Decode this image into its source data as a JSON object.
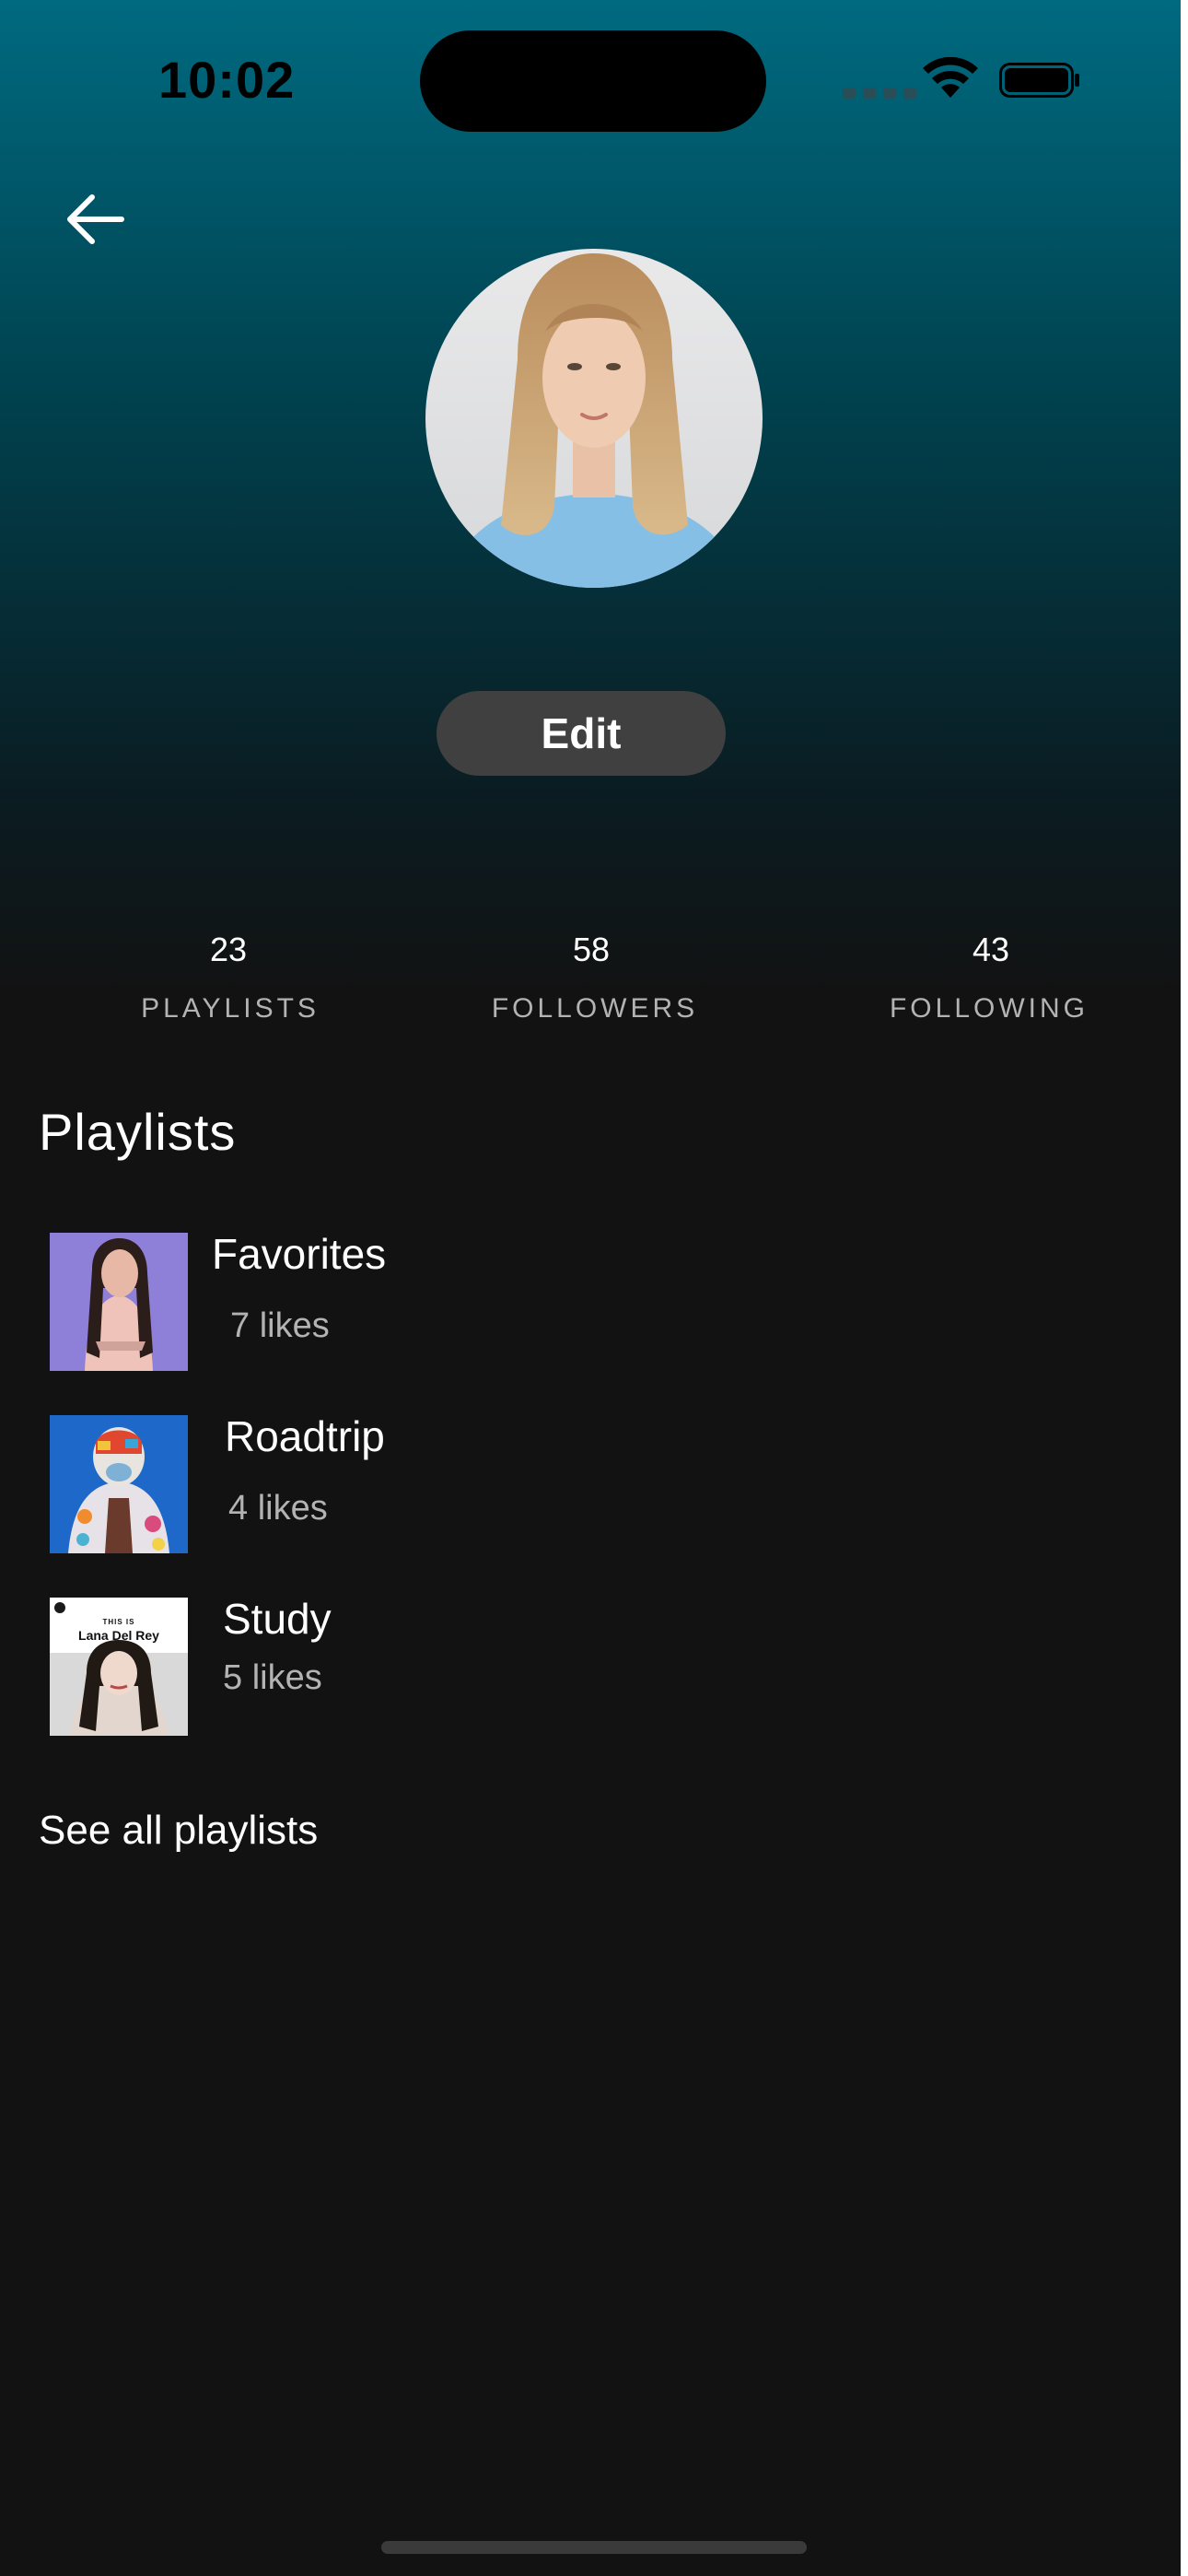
{
  "status_bar": {
    "time": "10:02",
    "icons": [
      "cellular-signal-icon",
      "wifi-icon",
      "battery-icon"
    ]
  },
  "nav": {
    "back_icon": "arrow-left-icon"
  },
  "profile": {
    "avatar_icon": "profile-photo"
  },
  "edit_button": {
    "label": "Edit"
  },
  "stats": [
    {
      "count": "23",
      "label": "PLAYLISTS"
    },
    {
      "count": "58",
      "label": "FOLLOWERS"
    },
    {
      "count": "43",
      "label": "FOLLOWING"
    }
  ],
  "playlists_section": {
    "title": "Playlists",
    "items": [
      {
        "name": "Favorites",
        "likes": "7 likes"
      },
      {
        "name": "Roadtrip",
        "likes": "4 likes"
      },
      {
        "name": "Study",
        "likes": "5 likes",
        "cover_text_top": "THIS IS",
        "cover_text_title": "Lana Del Rey"
      }
    ],
    "see_all_label": "See all playlists"
  },
  "colors": {
    "background": "#121212",
    "gradient_top": "#006a80",
    "button_bg": "#404040",
    "secondary_text": "#b3b3b3"
  }
}
